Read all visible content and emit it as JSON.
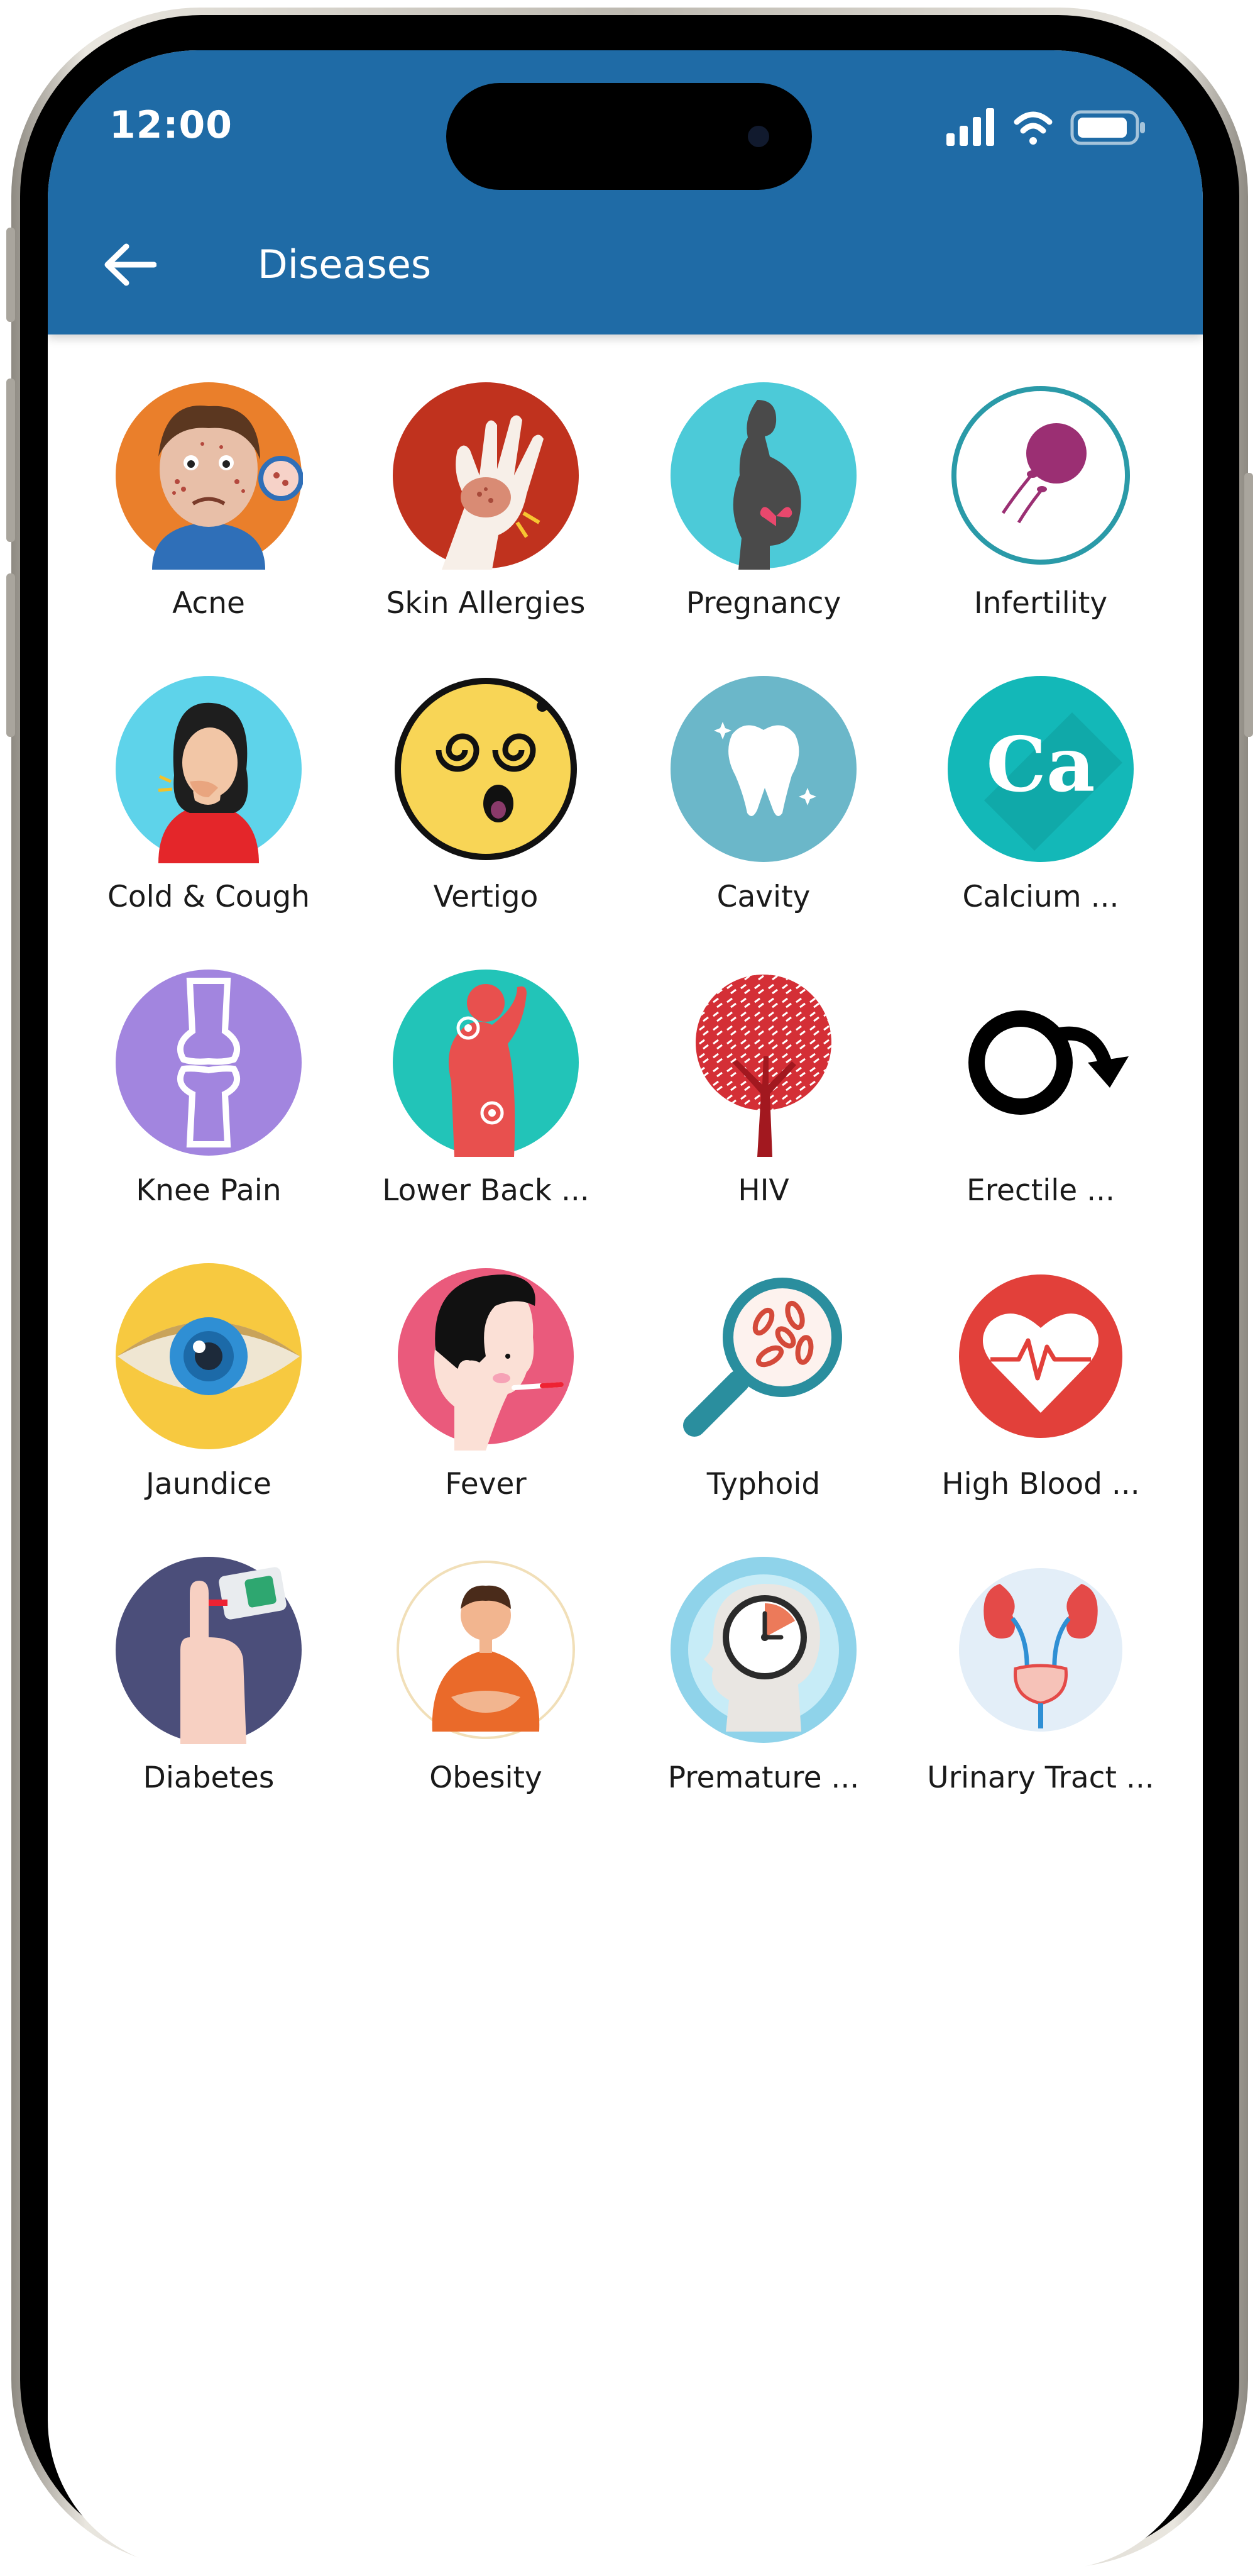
{
  "status_bar": {
    "time": "12:00",
    "icons": [
      "signal-icon",
      "wifi-icon",
      "battery-icon"
    ]
  },
  "app_bar": {
    "title": "Diseases",
    "back_icon": "arrow-left-icon",
    "color": "#1f6ba6"
  },
  "diseases": [
    {
      "label": "Acne",
      "icon": "acne-icon"
    },
    {
      "label": "Skin Allergies",
      "icon": "skin-allergies-icon"
    },
    {
      "label": "Pregnancy",
      "icon": "pregnancy-icon"
    },
    {
      "label": "Infertility",
      "icon": "infertility-icon"
    },
    {
      "label": "Cold & Cough",
      "icon": "cold-cough-icon"
    },
    {
      "label": "Vertigo",
      "icon": "vertigo-icon"
    },
    {
      "label": "Cavity",
      "icon": "cavity-icon"
    },
    {
      "label": "Calcium ...",
      "icon": "calcium-icon",
      "icon_text": "Ca"
    },
    {
      "label": "Knee Pain",
      "icon": "knee-pain-icon"
    },
    {
      "label": "Lower Back ...",
      "icon": "lower-back-icon"
    },
    {
      "label": "HIV",
      "icon": "hiv-icon"
    },
    {
      "label": "Erectile ...",
      "icon": "erectile-icon"
    },
    {
      "label": "Jaundice",
      "icon": "jaundice-icon"
    },
    {
      "label": "Fever",
      "icon": "fever-icon"
    },
    {
      "label": "Typhoid",
      "icon": "typhoid-icon"
    },
    {
      "label": "High Blood ...",
      "icon": "high-blood-icon"
    },
    {
      "label": "Diabetes",
      "icon": "diabetes-icon"
    },
    {
      "label": "Obesity",
      "icon": "obesity-icon"
    },
    {
      "label": "Premature ...",
      "icon": "premature-icon"
    },
    {
      "label": "Urinary Tract ...",
      "icon": "urinary-tract-icon"
    }
  ]
}
